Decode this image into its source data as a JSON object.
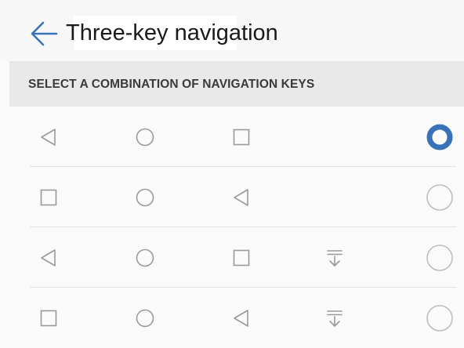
{
  "header": {
    "title": "Three-key navigation",
    "back_icon": "arrow-left-icon"
  },
  "section": {
    "title": "SELECT A COMBINATION OF NAVIGATION KEYS"
  },
  "colors": {
    "accent": "#3a72b8",
    "icon": "#9a9a9a",
    "radio_off": "#bdbdbd"
  },
  "options": [
    {
      "keys": [
        "back-triangle-icon",
        "home-circle-icon",
        "recents-square-icon"
      ],
      "selected": true
    },
    {
      "keys": [
        "recents-square-icon",
        "home-circle-icon",
        "back-triangle-icon"
      ],
      "selected": false
    },
    {
      "keys": [
        "back-triangle-icon",
        "home-circle-icon",
        "recents-square-icon",
        "notification-pulldown-icon"
      ],
      "selected": false
    },
    {
      "keys": [
        "recents-square-icon",
        "home-circle-icon",
        "back-triangle-icon",
        "notification-pulldown-icon"
      ],
      "selected": false
    }
  ]
}
